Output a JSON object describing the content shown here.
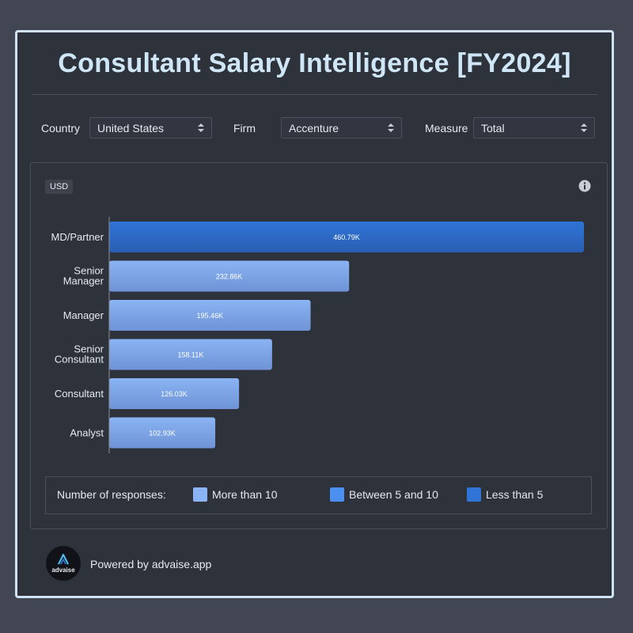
{
  "title": "Consultant Salary Intelligence [FY2024]",
  "filters": [
    {
      "label": "Country",
      "value": "United States"
    },
    {
      "label": "Firm",
      "value": "Accenture"
    },
    {
      "label": "Measure",
      "value": "Total"
    }
  ],
  "currency": "USD",
  "info_icon": "info-icon",
  "chart_data": {
    "type": "bar",
    "orientation": "horizontal",
    "title": "",
    "xlabel": "",
    "ylabel": "",
    "categories": [
      [
        "MD/Partner"
      ],
      [
        "Senior",
        "Manager"
      ],
      [
        "Manager"
      ],
      [
        "Senior",
        "Consultant"
      ],
      [
        "Consultant"
      ],
      [
        "Analyst"
      ]
    ],
    "values": [
      460.79,
      232.86,
      195.46,
      158.11,
      126.03,
      102.93
    ],
    "value_labels": [
      "460.79K",
      "232.86K",
      "195.46K",
      "158.11K",
      "126.03K",
      "102.93K"
    ],
    "response_group": [
      "Less than 5",
      "More than 10",
      "More than 10",
      "More than 10",
      "More than 10",
      "More than 10"
    ],
    "xlim": [
      0,
      460.79
    ],
    "grid": false
  },
  "legend": {
    "title": "Number of responses:",
    "items": [
      {
        "label": "More than 10",
        "color": "#8ab4f4"
      },
      {
        "label": "Between 5 and 10",
        "color": "#4b8ff0"
      },
      {
        "label": "Less than 5",
        "color": "#2f74d6"
      }
    ]
  },
  "footer": {
    "logo_text": "advaise",
    "powered_by": "Powered by advaise.app"
  }
}
